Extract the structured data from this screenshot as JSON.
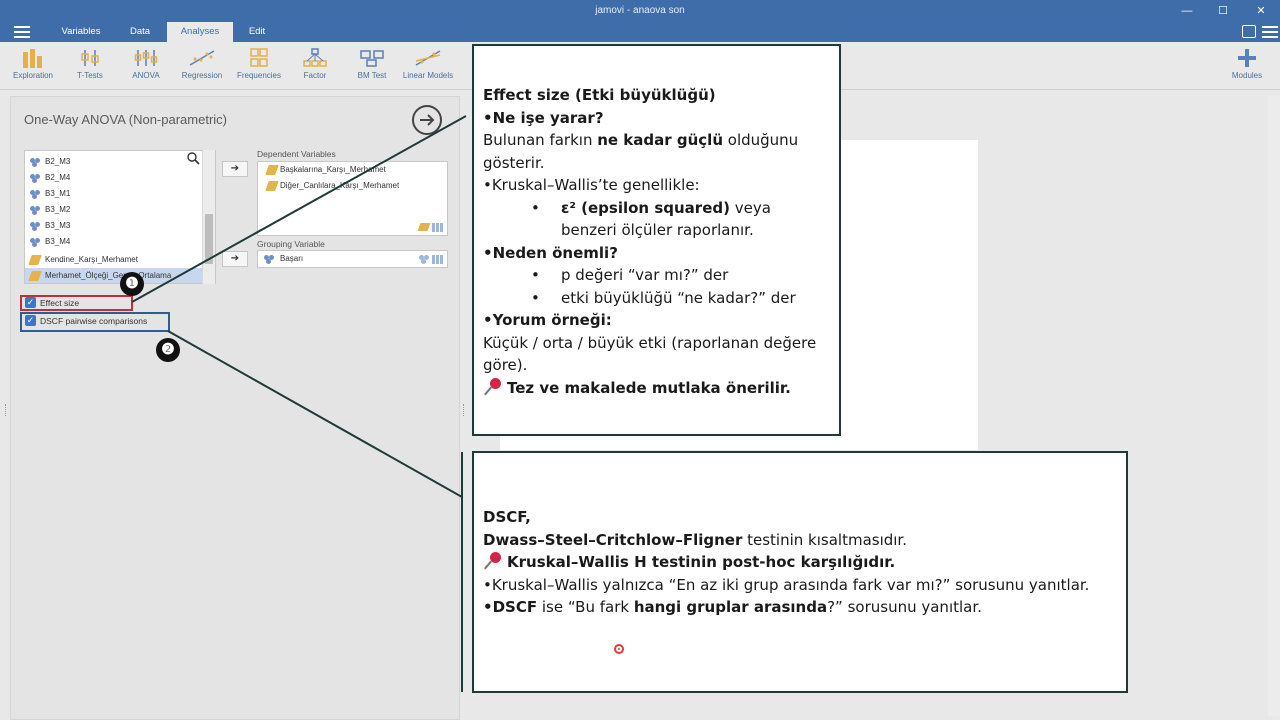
{
  "window": {
    "title": "jamovi - anaova son",
    "min": "—",
    "max": "☐",
    "close": "✕"
  },
  "menu": {
    "tabs": [
      {
        "label": "Variables"
      },
      {
        "label": "Data"
      },
      {
        "label": "Analyses"
      },
      {
        "label": "Edit"
      }
    ]
  },
  "toolbar": {
    "items": [
      {
        "label": "Exploration",
        "icon": "exploration-icon"
      },
      {
        "label": "T-Tests",
        "icon": "ttests-icon"
      },
      {
        "label": "ANOVA",
        "icon": "anova-icon"
      },
      {
        "label": "Regression",
        "icon": "regression-icon"
      },
      {
        "label": "Frequencies",
        "icon": "frequencies-icon"
      },
      {
        "label": "Factor",
        "icon": "factor-icon"
      },
      {
        "label": "BM Test",
        "icon": "bmtest-icon"
      },
      {
        "label": "Linear Models",
        "icon": "linear-models-icon"
      }
    ],
    "modules_label": "Modules"
  },
  "analysis": {
    "title": "One-Way ANOVA (Non-parametric)",
    "variables": [
      {
        "name": "B2_M3",
        "type": "nominal"
      },
      {
        "name": "B2_M4",
        "type": "nominal"
      },
      {
        "name": "B3_M1",
        "type": "nominal"
      },
      {
        "name": "B3_M2",
        "type": "nominal"
      },
      {
        "name": "B3_M3",
        "type": "nominal"
      },
      {
        "name": "B3_M4",
        "type": "nominal"
      },
      {
        "name": "Kendine_Karşı_Merhamet",
        "type": "continuous"
      },
      {
        "name": "Merhamet_Ölçeği_Genel_Ortalama",
        "type": "continuous"
      }
    ],
    "dependent_label": "Dependent Variables",
    "dependent": [
      {
        "name": "Başkalarına_Karşı_Merhamet"
      },
      {
        "name": "Diğer_Canlılara_Karşı_Merhamet"
      }
    ],
    "grouping_label": "Grouping Variable",
    "grouping": {
      "name": "Başarı"
    },
    "arrow": "➔",
    "options": [
      {
        "label": "Effect size",
        "checked": true
      },
      {
        "label": "DSCF pairwise comparisons",
        "checked": true
      }
    ],
    "badges": [
      "❶",
      "❷"
    ]
  },
  "callout1": {
    "title": "Effect size (Etki büyüklüğü)",
    "q1": "•Ne işe yarar?",
    "p1_a": "Bulunan farkın ",
    "p1_b": "ne kadar güçlü",
    "p1_c": " olduğunu gösterir.",
    "p2": "•Kruskal–Wallis’te genellikle:",
    "sub1_bold": "ε² (epsilon squared)",
    "sub1_rest": " veya benzeri ölçüler raporlanır.",
    "q2": "•Neden önemli?",
    "sub2": "p değeri “var mı?” der",
    "sub3": "etki büyüklüğü “ne kadar?” der",
    "q3": "•Yorum örneği:",
    "p3": "Küçük / orta / büyük etki (raporlanan değere göre).",
    "note": "Tez ve makalede mutlaka önerilir."
  },
  "callout2": {
    "title": "DSCF,",
    "full_bold": "Dwass–Steel–Critchlow–Fligner",
    "full_rest": " testinin kısaltmasıdır.",
    "note": "Kruskal–Wallis H testinin post-hoc karşılığıdır.",
    "p1": "•Kruskal–Wallis yalnızca “En az iki grup arasında fark var mı?” sorusunu yanıtlar.",
    "p2_a": "•DSCF",
    "p2_b": " ise “Bu fark ",
    "p2_c": "hangi gruplar arasında",
    "p2_d": "?” sorusunu yanıtlar."
  }
}
